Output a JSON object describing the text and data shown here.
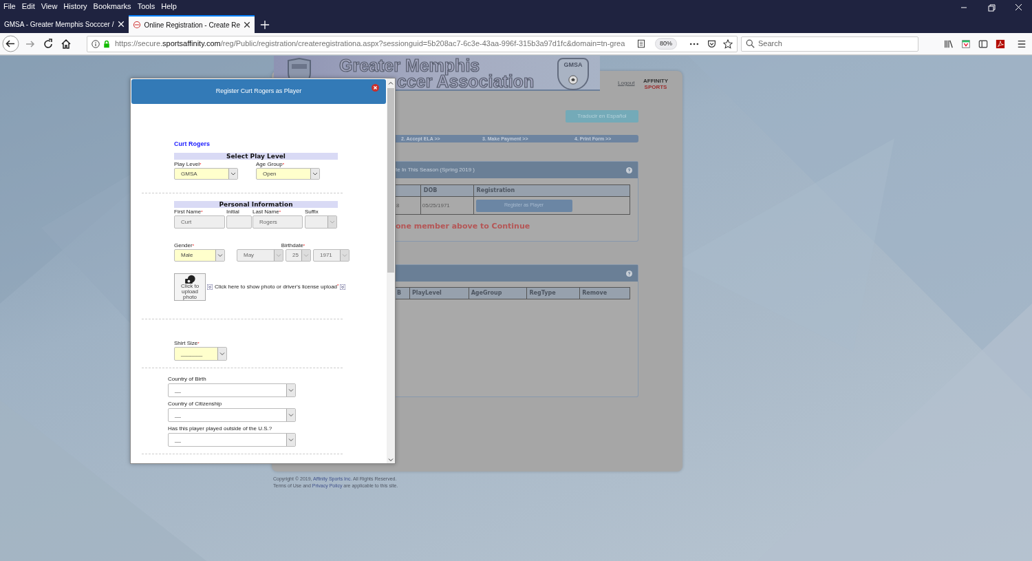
{
  "menu": [
    "File",
    "Edit",
    "View",
    "History",
    "Bookmarks",
    "Tools",
    "Help"
  ],
  "tabs": [
    {
      "label": "GMSA - Greater Memphis Socccer /",
      "selected": false
    },
    {
      "label": "Online Registration - Create Re",
      "selected": true
    }
  ],
  "address": {
    "url_prefix": "https://secure.",
    "url_domain": "sportsaffinity.com",
    "url_rest": "/reg/Public/registration/createregistrationa.aspx?sessionguid=5b208ac7-6c3e-43aa-996f-315b3a97d1fc&domain=tn-grea",
    "zoom": "80%"
  },
  "search": {
    "placeholder": "Search"
  },
  "page": {
    "banner_lines": [
      "Greater Memphis",
      "ccer Association"
    ],
    "crest": "GMSA",
    "logout": "Logout",
    "brand_lines": [
      "AFFINITY",
      "SPORTS"
    ],
    "translate_button": "Traducir en Español",
    "steps": [
      "2. Accept ELA >>",
      "3. Make Payment >>",
      "4. Print Form >>"
    ],
    "season_panel": {
      "title": "te In This Season (Spring 2019 )",
      "columns": [
        "",
        "DOB",
        "Registration"
      ],
      "row": [
        "8",
        "05/25/1971"
      ],
      "button": "Register as Player",
      "message": "one member above to Continue"
    },
    "selection_panel": {
      "columns": [
        "B",
        "PlayLevel",
        "AgeGroup",
        "RegType",
        "Remove"
      ]
    },
    "footer": [
      {
        "before": "Copyright © 2019, ",
        "link": "Affinity Sports Inc.",
        "after": " All Rights Reserved."
      },
      {
        "before": "Terms of Use and ",
        "link": "Privacy Policy",
        "after": " are applicable to this site."
      }
    ]
  },
  "modal": {
    "title": "Register Curt Rogers as Player",
    "member": "Curt Rogers",
    "play_section": {
      "heading": "Select Play Level",
      "fields": [
        {
          "label": "Play Level",
          "mark": "*",
          "kind": "select",
          "value": "GMSA",
          "highlighted": true,
          "disabled": false
        },
        {
          "label": "Age Group",
          "mark": "*",
          "kind": "select",
          "value": "Open",
          "highlighted": true,
          "disabled": false
        }
      ]
    },
    "personal_section": {
      "heading": "Personal Information",
      "fields": [
        {
          "label": "First Name",
          "mark": "*",
          "kind": "text",
          "value": "Curt",
          "highlighted": false,
          "disabled": true
        },
        {
          "label": "Initial",
          "kind": "text",
          "highlighted": false,
          "disabled": true
        },
        {
          "label": "Last Name",
          "mark": "*",
          "kind": "text",
          "value": "Rogers",
          "highlighted": false,
          "disabled": true
        },
        {
          "label": "Suffix",
          "kind": "select",
          "highlighted": false,
          "disabled": true
        }
      ],
      "gender": {
        "label": "Gender",
        "mark": "*",
        "kind": "select",
        "value": "Male",
        "highlighted": true,
        "disabled": false
      },
      "birthdate": {
        "label": "Birthdate",
        "mark": "*",
        "parts": [
          {
            "kind": "select",
            "value": "May",
            "highlighted": false,
            "disabled": true
          },
          {
            "kind": "select",
            "value": "25",
            "highlighted": false,
            "disabled": true
          },
          {
            "kind": "select",
            "value": "1971",
            "highlighted": false,
            "disabled": true
          }
        ]
      }
    },
    "upload": {
      "caption": "Click to upload photo",
      "text": "Click here to show photo or driver's license upload",
      "mark": "*"
    },
    "shirt": {
      "label": "Shirt Size",
      "mark": "*",
      "kind": "select",
      "value": "_______",
      "highlighted": true,
      "disabled": false
    },
    "extra_fields": [
      {
        "label": "Country of Birth",
        "kind": "select",
        "value": "__",
        "highlighted": false,
        "disabled": false
      },
      {
        "label": "Country of Citizenship",
        "kind": "select",
        "value": "__",
        "highlighted": false,
        "disabled": false
      },
      {
        "label": "Has this player played outside of the U.S.?",
        "kind": "select",
        "value": "__",
        "highlighted": false,
        "disabled": false
      }
    ]
  }
}
